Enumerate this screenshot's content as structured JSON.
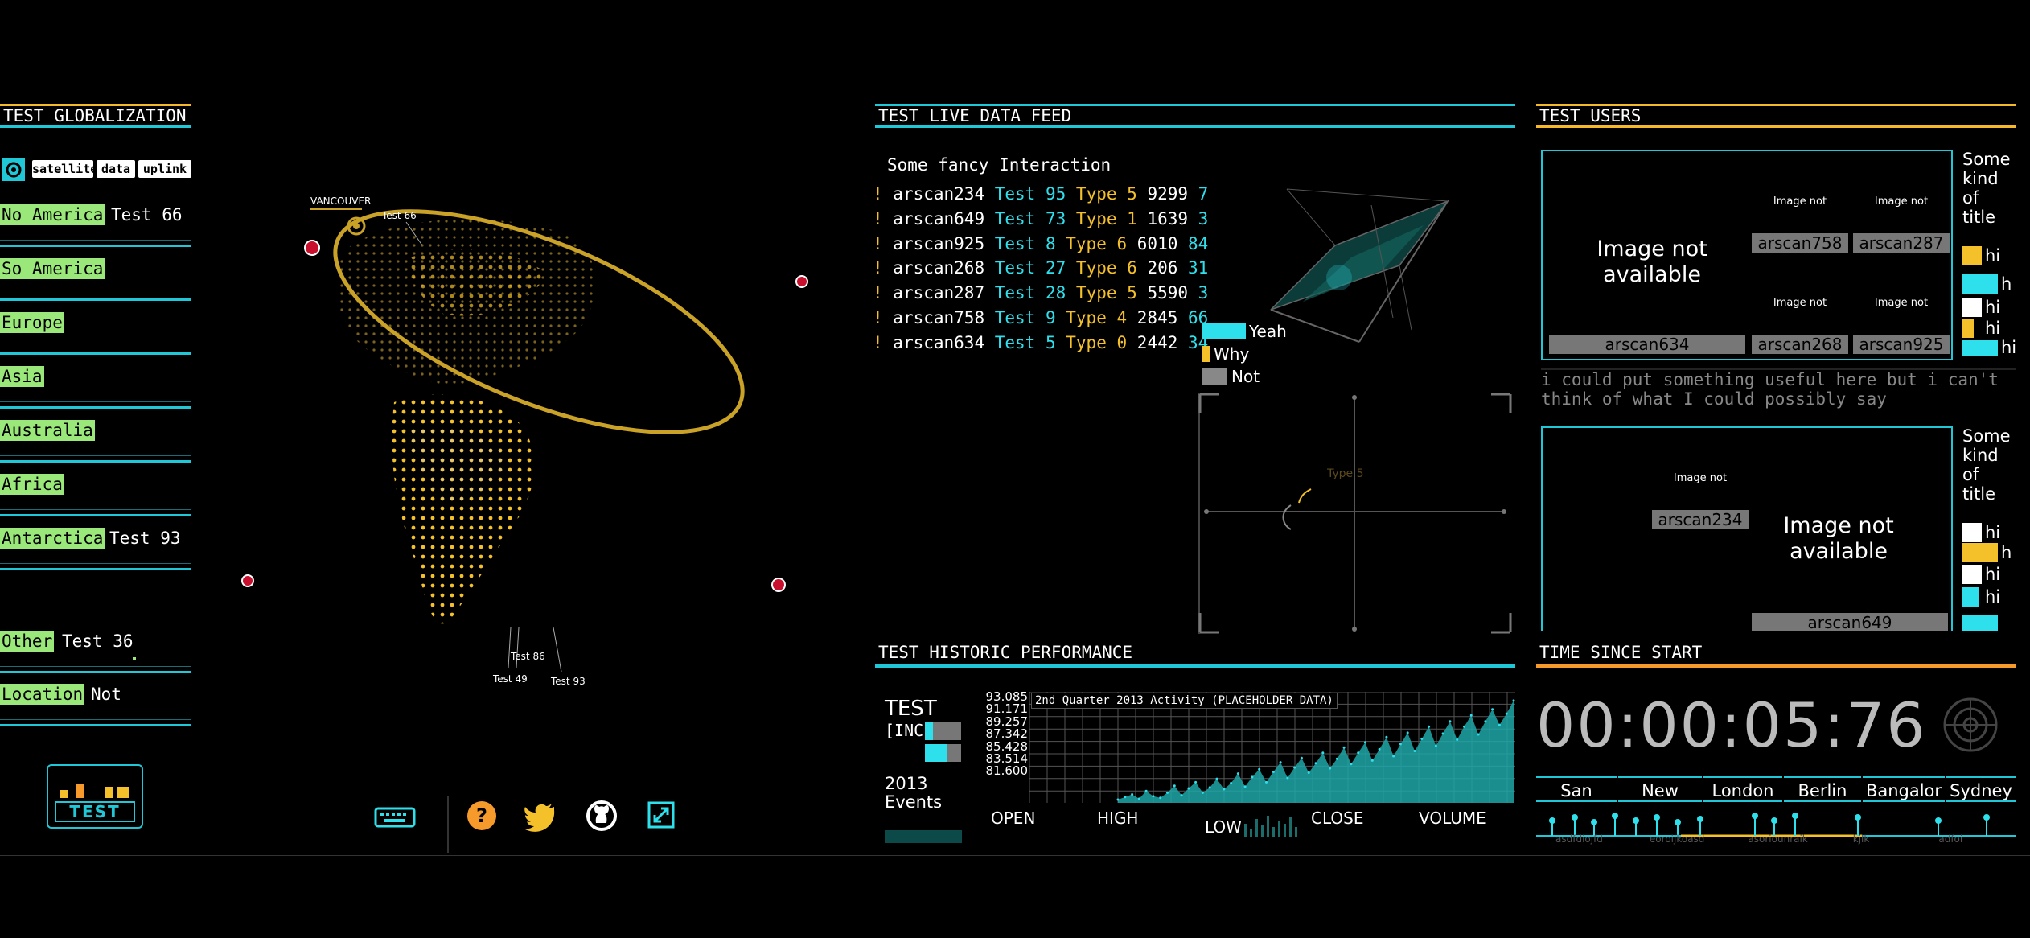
{
  "globalization": {
    "title": "TEST GLOBALIZATION",
    "modes": [
      "satellite",
      "data",
      "uplink"
    ],
    "regions": [
      {
        "label": "No America",
        "value": "Test 66"
      },
      {
        "label": "So America",
        "value": ""
      },
      {
        "label": "Europe",
        "value": ""
      },
      {
        "label": "Asia",
        "value": ""
      },
      {
        "label": "Australia",
        "value": ""
      },
      {
        "label": "Africa",
        "value": ""
      },
      {
        "label": "Antarctica",
        "value": "Test 93"
      }
    ],
    "other": {
      "label": "Other",
      "value": "Test 36"
    },
    "location": {
      "label": "Location",
      "value": "Not Specifi"
    },
    "logo_text": "TEST"
  },
  "globe": {
    "city_label": "VANCOUVER",
    "markers": [
      "Test 66",
      "Test 86",
      "Test 49",
      "Test 93"
    ],
    "colors": {
      "dots": "#f5c12b",
      "orbit": "#c9a227"
    }
  },
  "live_feed": {
    "title": "TEST LIVE DATA FEED",
    "heading": "Some fancy Interaction",
    "rows": [
      {
        "user": "arscan234",
        "test": "Test 95",
        "type": "Type 5",
        "n1": "9299",
        "n2": "7"
      },
      {
        "user": "arscan649",
        "test": "Test 73",
        "type": "Type 1",
        "n1": "1639",
        "n2": "3"
      },
      {
        "user": "arscan925",
        "test": "Test 8",
        "type": "Type 6",
        "n1": "6010",
        "n2": "84"
      },
      {
        "user": "arscan268",
        "test": "Test 27",
        "type": "Type 6",
        "n1": "206",
        "n2": "31"
      },
      {
        "user": "arscan287",
        "test": "Test 28",
        "type": "Type 5",
        "n1": "5590",
        "n2": "3"
      },
      {
        "user": "arscan758",
        "test": "Test 9",
        "type": "Type 4",
        "n1": "2845",
        "n2": "66"
      },
      {
        "user": "arscan634",
        "test": "Test 5",
        "type": "Type 0",
        "n1": "2442",
        "n2": "34"
      }
    ],
    "legend": [
      {
        "label": "Yeah",
        "color": "#2ee0ec"
      },
      {
        "label": "Why",
        "color": "#f5c12b"
      },
      {
        "label": "Not",
        "color": "#888888"
      }
    ],
    "scope_label": "Type 5"
  },
  "users": {
    "title": "TEST USERS",
    "image_na": "Image not available",
    "image_na_small": "Image not",
    "panel1": {
      "big_user": "arscan634",
      "users_top": [
        "arscan758",
        "arscan287"
      ],
      "users_bottom": [
        "arscan268",
        "arscan925"
      ]
    },
    "panel2": {
      "small_user": "arscan234",
      "bottom_user": "arscan649"
    },
    "side_title": [
      "Some",
      "kind",
      "of",
      "title"
    ],
    "hi": "hi",
    "hi_clip": "h",
    "ticker": "i could put something useful here    but i can't think    of what    I could possibly    say"
  },
  "historic": {
    "title": "TEST HISTORIC PERFORMANCE",
    "ticker_title": "TEST",
    "ticker_sub": "[INC",
    "year_label": "2013",
    "events_label": "Events",
    "chart_title": "2nd Quarter 2013 Activity (PLACEHOLDER DATA)",
    "y_ticks": [
      "93.085",
      "91.171",
      "89.257",
      "87.342",
      "85.428",
      "83.514",
      "81.600"
    ],
    "stats": [
      "OPEN",
      "HIGH",
      "LOW",
      "CLOSE",
      "VOLUME"
    ]
  },
  "chart_data": {
    "type": "area",
    "title": "2nd Quarter 2013 Activity (PLACEHOLDER DATA)",
    "ylim": [
      81.6,
      93.085
    ],
    "y_ticks": [
      93.085,
      91.171,
      89.257,
      87.342,
      85.428,
      83.514,
      81.6
    ],
    "values": [
      81.6,
      81.9,
      82.2,
      81.7,
      82.6,
      82.0,
      81.8,
      82.4,
      83.2,
      82.1,
      82.9,
      83.6,
      82.4,
      83.0,
      84.0,
      82.8,
      83.5,
      84.6,
      83.1,
      84.2,
      85.1,
      83.6,
      84.8,
      85.9,
      84.1,
      85.3,
      86.4,
      84.7,
      85.8,
      87.0,
      85.2,
      86.3,
      87.6,
      85.7,
      87.0,
      88.2,
      86.1,
      87.4,
      88.8,
      86.6,
      88.0,
      89.3,
      87.2,
      88.6,
      90.0,
      87.8,
      89.2,
      90.6,
      88.5,
      90.0,
      91.3,
      89.1,
      90.6,
      92.0,
      90.2,
      91.5,
      93.0
    ]
  },
  "timer": {
    "title": "TIME SINCE START",
    "value": "00:00:05:76",
    "cities": [
      "San",
      "New",
      "London",
      "Berlin",
      "Bangalor",
      "Sydney"
    ],
    "tick_labels": [
      "asdfdiojfd",
      "eoroijkoasd",
      "asoriounraik",
      "kjlk",
      "adfoi"
    ]
  }
}
